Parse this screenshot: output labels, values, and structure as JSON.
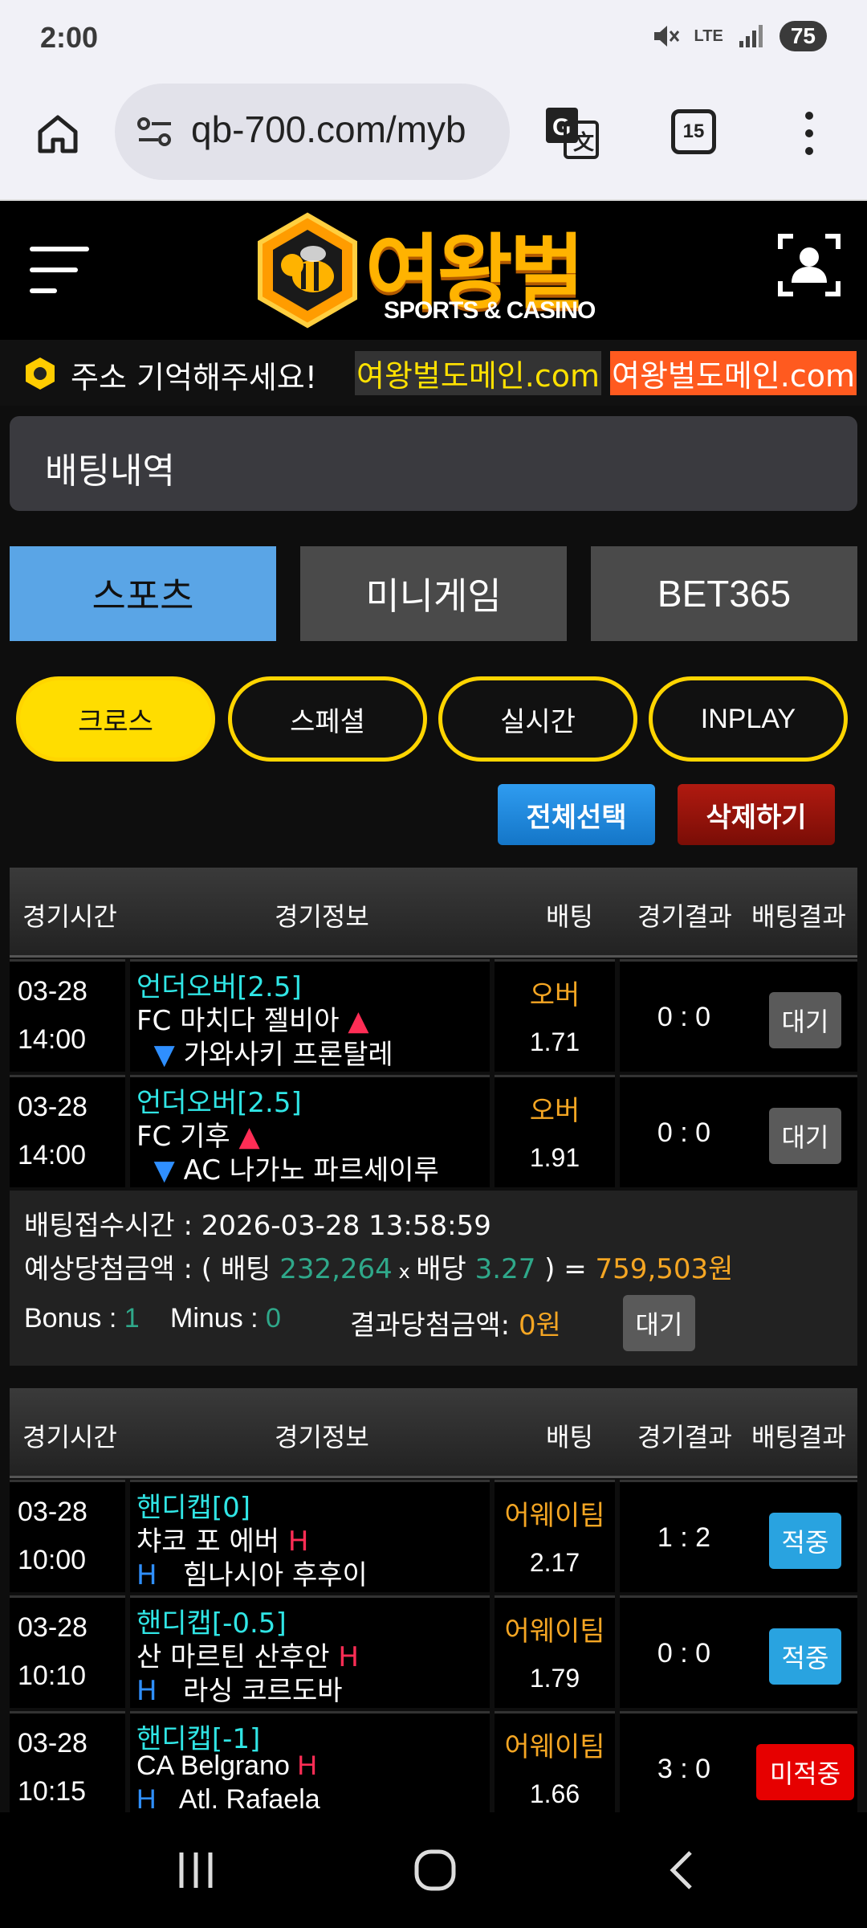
{
  "status_bar": {
    "time": "2:00",
    "battery": "75",
    "network": "LTE"
  },
  "browser": {
    "url": "qb-700.com/myb",
    "tab_count": "15"
  },
  "header": {
    "logo_title": "여왕벌",
    "logo_subtitle": "SPORTS & CASINO"
  },
  "ticker": {
    "notice": "주소 기억해주세요!",
    "domain1": "여왕벌도메인.com",
    "domain2": "여왕벌도메인.com"
  },
  "page": {
    "title": "배팅내역"
  },
  "tabs": [
    {
      "label": "스포츠"
    },
    {
      "label": "미니게임"
    },
    {
      "label": "BET365"
    }
  ],
  "filters": [
    {
      "label": "크로스"
    },
    {
      "label": "스페셜"
    },
    {
      "label": "실시간"
    },
    {
      "label": "INPLAY"
    }
  ],
  "actions": {
    "select_all": "전체선택",
    "delete": "삭제하기"
  },
  "columns": {
    "time": "경기시간",
    "info": "경기정보",
    "bet": "배팅",
    "score": "경기결과",
    "result": "배팅결과"
  },
  "slip1": {
    "rows": [
      {
        "date": "03-28",
        "time": "14:00",
        "market": "언더오버[2.5]",
        "home": "FC 마치다 젤비아",
        "away": "가와사키 프론탈레",
        "pick": "오버",
        "odds": "1.71",
        "score": "0 : 0",
        "status": "대기"
      },
      {
        "date": "03-28",
        "time": "14:00",
        "market": "언더오버[2.5]",
        "home": "FC 기후",
        "away": "AC 나가노 파르세이루",
        "pick": "오버",
        "odds": "1.91",
        "score": "0 : 0",
        "status": "대기"
      }
    ],
    "summary": {
      "accept_label": "배팅접수시간 : 2026-03-28 13:58:59",
      "expected_label": "예상당첨금액 : ( 배팅 ",
      "stake": "232,264",
      "times": " x ",
      "odds_label": "배당 ",
      "total_odds": "3.27",
      "close": " ) = ",
      "payout": "759,503원",
      "bonus_label": "Bonus : ",
      "bonus": "1",
      "minus_label": "Minus : ",
      "minus": "0",
      "result_label": "결과당첨금액: ",
      "result_amount": "0원",
      "status": "대기"
    }
  },
  "slip2": {
    "rows": [
      {
        "date": "03-28",
        "time": "10:00",
        "market": "핸디캡[0]",
        "home": "챠코 포 에버",
        "home_mark": "H",
        "away": "힘나시아 후후이",
        "away_mark": "H",
        "pick": "어웨이팀",
        "odds": "2.17",
        "score": "1 : 2",
        "status": "적중"
      },
      {
        "date": "03-28",
        "time": "10:10",
        "market": "핸디캡[-0.5]",
        "home": "산 마르틴 산후안",
        "home_mark": "H",
        "away": "라싱 코르도바",
        "away_mark": "H",
        "pick": "어웨이팀",
        "odds": "1.79",
        "score": "0 : 0",
        "status": "적중"
      },
      {
        "date": "03-28",
        "time": "10:15",
        "market": "핸디캡[-1]",
        "home": "CA Belgrano",
        "home_mark": "H",
        "away": "Atl. Rafaela",
        "away_mark": "H",
        "pick": "어웨이팀",
        "odds": "1.66",
        "score": "3 : 0",
        "status": "미적중"
      }
    ]
  },
  "colors": {
    "win": "#29a3e0",
    "lose": "#e60000",
    "pending": "#5a5a5a",
    "accent": "#ffdd00"
  }
}
